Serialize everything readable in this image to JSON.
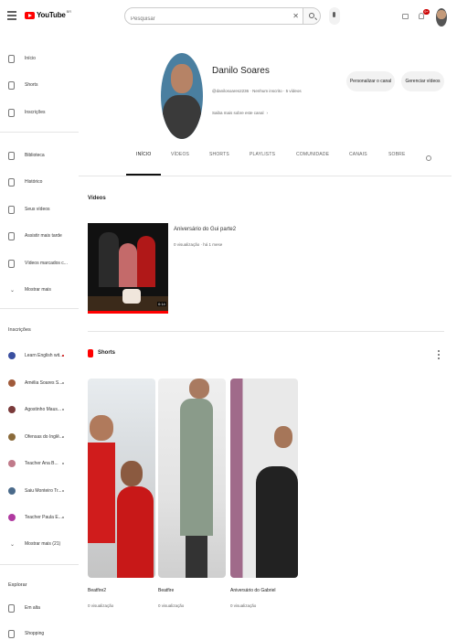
{
  "header": {
    "logo_text": "YouTube",
    "logo_country": "BR",
    "search_placeholder": "Pesquisar",
    "notification_count": "9+"
  },
  "sidebar": {
    "main": [
      {
        "label": "Início",
        "icon": "home-icon"
      },
      {
        "label": "Shorts",
        "icon": "shorts-icon"
      },
      {
        "label": "Inscrições",
        "icon": "subscriptions-icon"
      }
    ],
    "library": [
      {
        "label": "Biblioteca",
        "icon": "library-icon"
      },
      {
        "label": "Histórico",
        "icon": "history-icon"
      },
      {
        "label": "Seus vídeos",
        "icon": "your-videos-icon"
      },
      {
        "label": "Assistir mais tarde",
        "icon": "watch-later-icon"
      },
      {
        "label": "Vídeos marcados c...",
        "icon": "liked-icon"
      },
      {
        "label": "Mostrar mais",
        "icon": "chevron-down-icon"
      }
    ],
    "subscriptions_heading": "Inscrições",
    "subscriptions": [
      {
        "label": "Learn English wit...",
        "color": "#3a4fa0",
        "live": true
      },
      {
        "label": "Amélia Soares S...",
        "color": "#a05a3a",
        "live": false
      },
      {
        "label": "Agostinho Maus...",
        "color": "#7a3a3a",
        "live": false
      },
      {
        "label": "Ofensas do Inglê...",
        "color": "#8a6a3a",
        "live": false
      },
      {
        "label": "Teacher Ana B...",
        "color": "#c07a8a",
        "live": false
      },
      {
        "label": "Saiu Monteiro Tr...",
        "color": "#4a6a8a",
        "live": false
      },
      {
        "label": "Teacher Paula E...",
        "color": "#b03aa0",
        "live": false
      },
      {
        "label": "Mostrar mais (21)",
        "color": "",
        "live": false
      }
    ],
    "explore_heading": "Explorar",
    "explore": [
      {
        "label": "Em alta",
        "icon": "trending-icon"
      },
      {
        "label": "Shopping",
        "icon": "shopping-icon"
      }
    ]
  },
  "channel": {
    "name": "Danilo Soares",
    "meta": "@danilosoares2236 · Nenhum inscrito · 5 vídeos",
    "about": "Saiba mais sobre este canal",
    "about_chevron": "›",
    "customize_label": "Personalizar o canal",
    "manage_label": "Gerenciar vídeos"
  },
  "tabs": [
    {
      "label": "INÍCIO",
      "active": true
    },
    {
      "label": "VÍDEOS",
      "active": false
    },
    {
      "label": "SHORTS",
      "active": false
    },
    {
      "label": "PLAYLISTS",
      "active": false
    },
    {
      "label": "COMUNIDADE",
      "active": false
    },
    {
      "label": "CANAIS",
      "active": false
    },
    {
      "label": "SOBRE",
      "active": false
    }
  ],
  "videos_section": {
    "title": "Vídeos",
    "video": {
      "title": "Aniversário do Gui parte2",
      "meta": "0 visualização · há 1 mese",
      "duration": "0:14",
      "watched_fraction": 1.0
    }
  },
  "shorts_section": {
    "title": "Shorts",
    "items": [
      {
        "title": "Beatfire2",
        "views": "0 visualização"
      },
      {
        "title": "Beatfire",
        "views": "0 visualização"
      },
      {
        "title": "Aniversário do Gabriel",
        "views": "0 visualização"
      }
    ]
  }
}
